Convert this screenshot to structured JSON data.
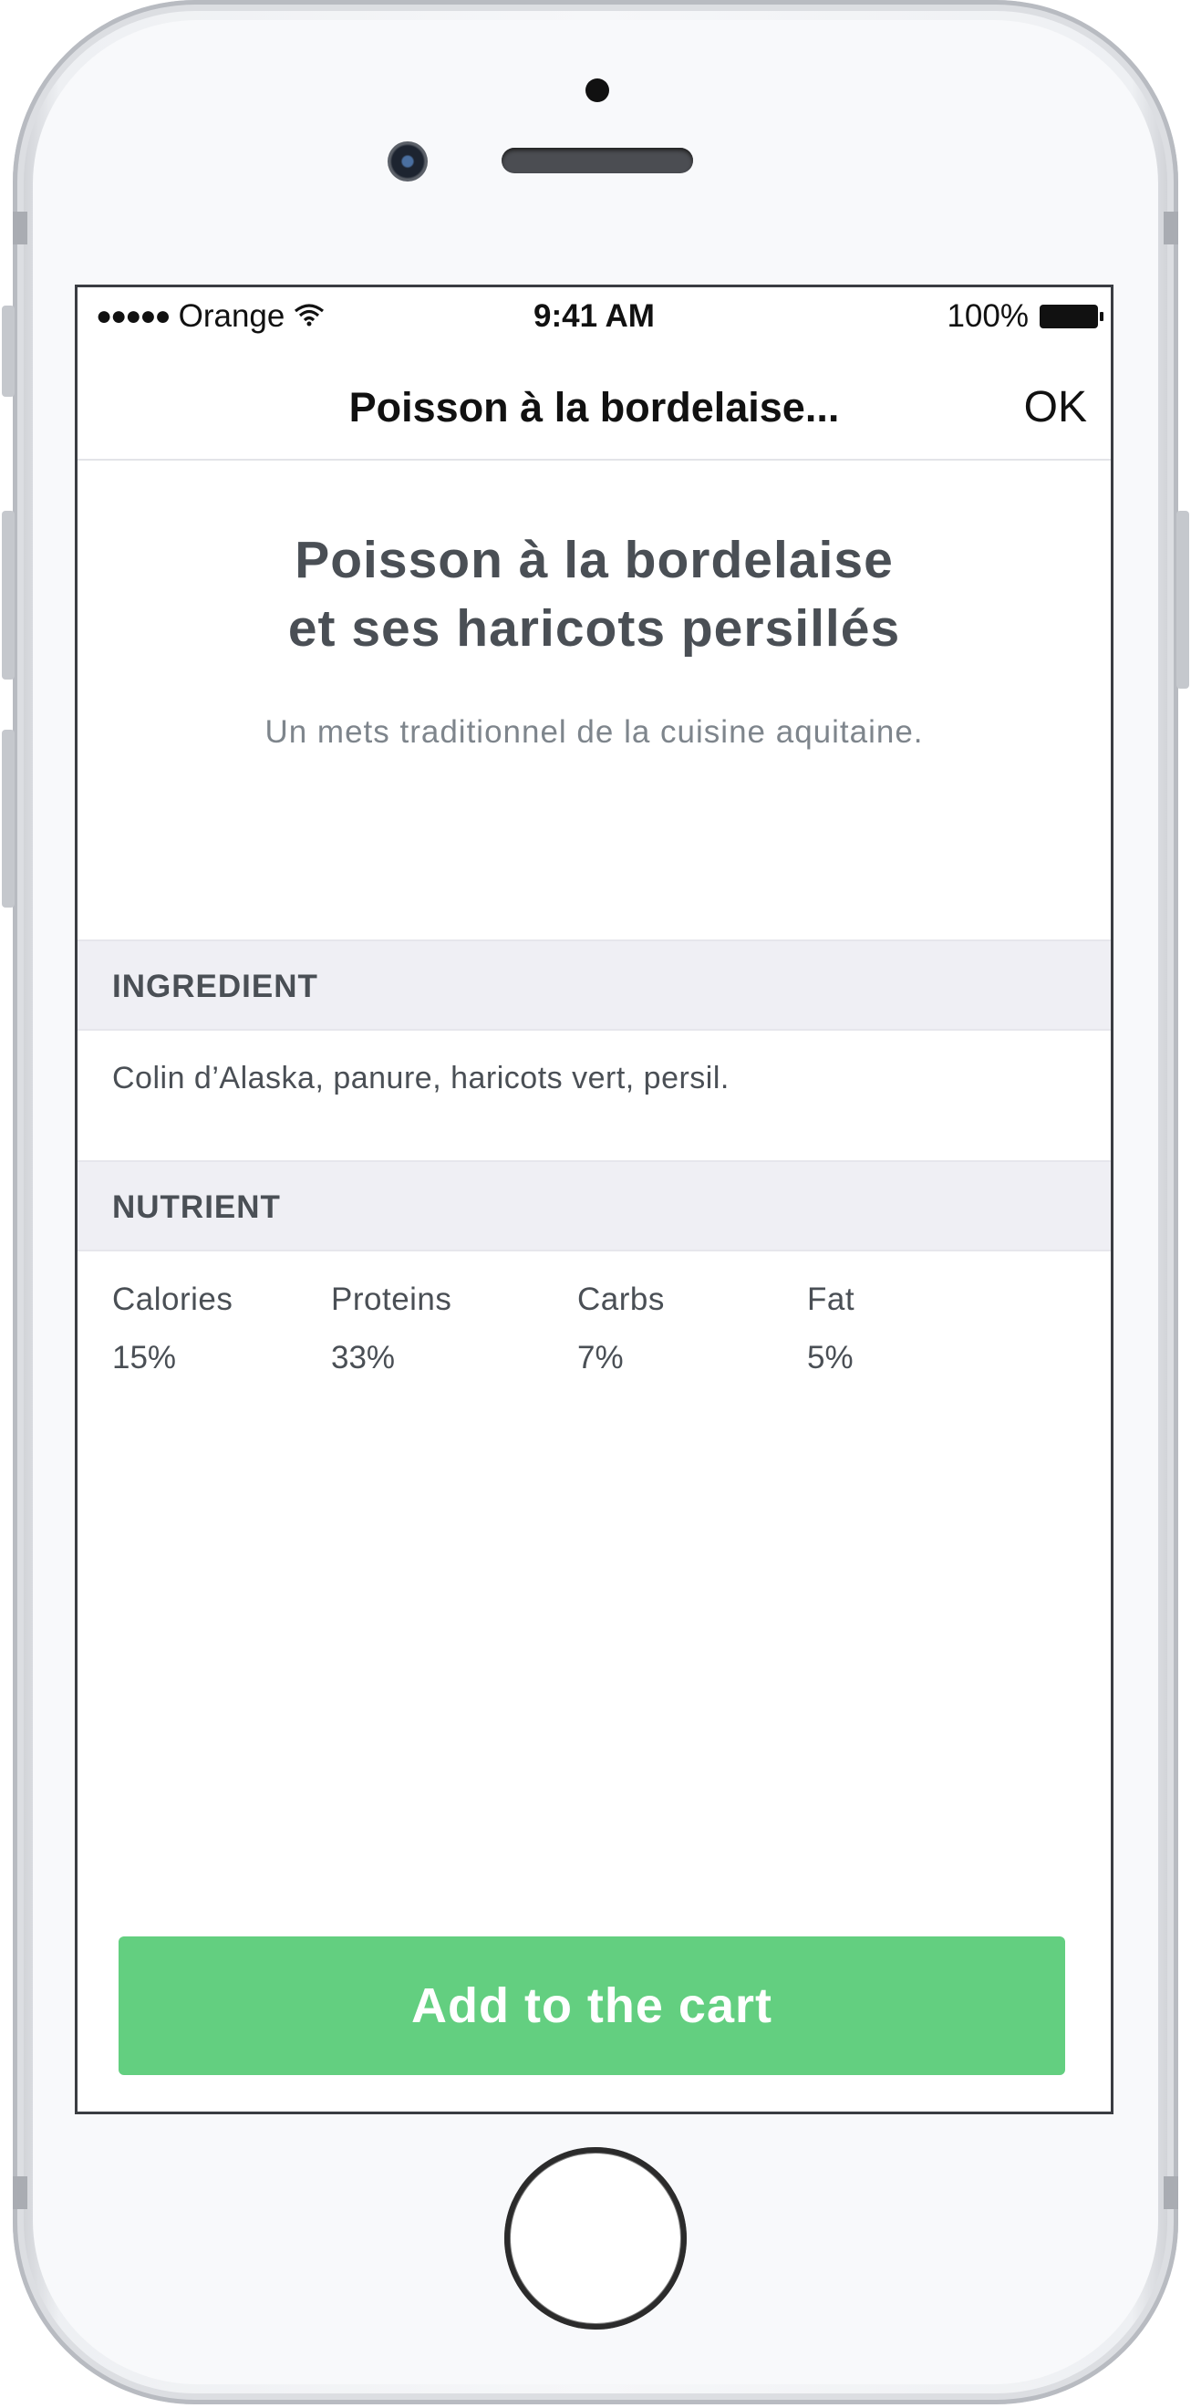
{
  "status_bar": {
    "signal_dots": "●●●●●",
    "carrier": "Orange",
    "wifi_icon": "wifi-icon",
    "time": "9:41 AM",
    "battery_percent": "100%",
    "battery_icon": "battery-full-icon"
  },
  "nav": {
    "title": "Poisson à la bordelaise...",
    "ok_label": "OK"
  },
  "dish": {
    "title_line1": "Poisson à la bordelaise",
    "title_line2": "et ses haricots persillés",
    "subtitle": "Un mets traditionnel de la cuisine aquitaine."
  },
  "ingredient_section": {
    "header": "INGREDIENT",
    "text": "Colin d’Alaska, panure, haricots vert, persil."
  },
  "nutrient_section": {
    "header": "NUTRIENT",
    "items": [
      {
        "label": "Calories",
        "value": "15%"
      },
      {
        "label": "Proteins",
        "value": "33%"
      },
      {
        "label": "Carbs",
        "value": "7%"
      },
      {
        "label": "Fat",
        "value": "5%"
      }
    ]
  },
  "cart_button_label": "Add to the cart",
  "colors": {
    "accent_green": "#63cf80",
    "section_bg": "#efeff4",
    "text_dark": "#4a4f55"
  }
}
